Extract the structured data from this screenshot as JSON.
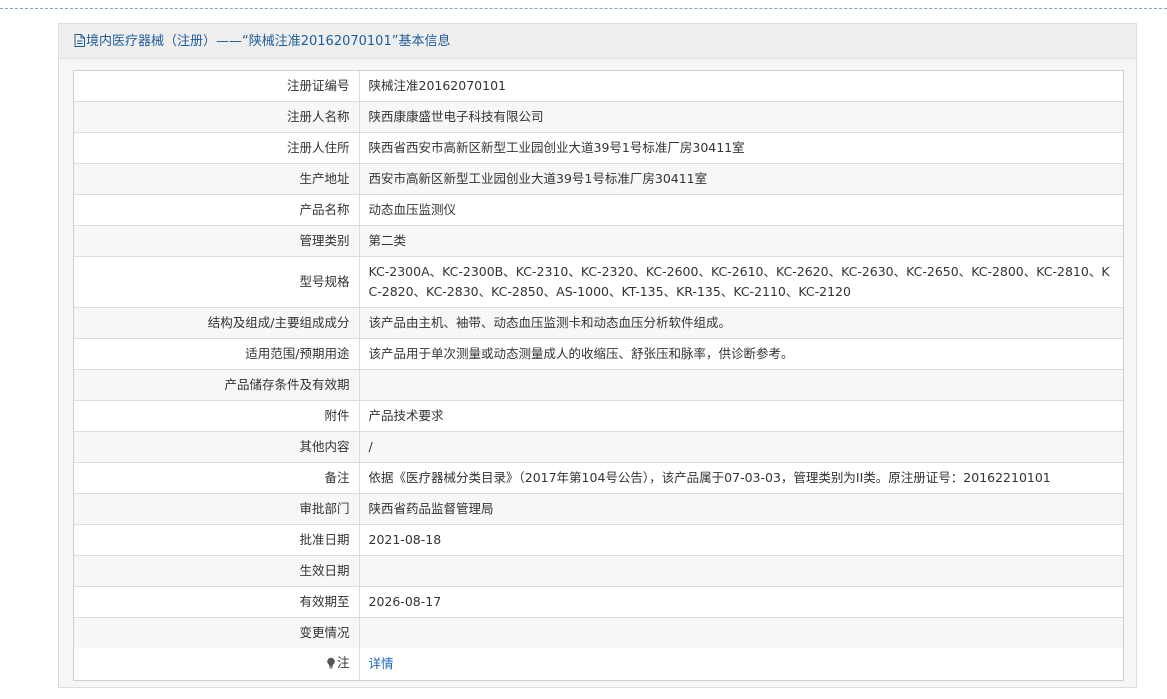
{
  "header": {
    "title": "境内医疗器械（注册）——“陕械注准20162070101”基本信息"
  },
  "rows": [
    {
      "label": "注册证编号",
      "value": "陕械注准20162070101"
    },
    {
      "label": "注册人名称",
      "value": "陕西康康盛世电子科技有限公司"
    },
    {
      "label": "注册人住所",
      "value": "陕西省西安市高新区新型工业园创业大道39号1号标准厂房30411室"
    },
    {
      "label": "生产地址",
      "value": "西安市高新区新型工业园创业大道39号1号标准厂房30411室"
    },
    {
      "label": "产品名称",
      "value": "动态血压监测仪"
    },
    {
      "label": "管理类别",
      "value": "第二类"
    },
    {
      "label": "型号规格",
      "value": "KC-2300A、KC-2300B、KC-2310、KC-2320、KC-2600、KC-2610、KC-2620、KC-2630、KC-2650、KC-2800、KC-2810、KC-2820、KC-2830、KC-2850、AS-1000、KT-135、KR-135、KC-2110、KC-2120"
    },
    {
      "label": "结构及组成/主要组成成分",
      "value": "该产品由主机、袖带、动态血压监测卡和动态血压分析软件组成。"
    },
    {
      "label": "适用范围/预期用途",
      "value": "该产品用于单次测量或动态测量成人的收缩压、舒张压和脉率，供诊断参考。"
    },
    {
      "label": "产品储存条件及有效期",
      "value": ""
    },
    {
      "label": "附件",
      "value": "产品技术要求"
    },
    {
      "label": "其他内容",
      "value": "/"
    },
    {
      "label": "备注",
      "value": "依据《医疗器械分类目录》（2017年第104号公告），该产品属于07-03-03，管理类别为II类。原注册证号：20162210101"
    },
    {
      "label": "审批部门",
      "value": "陕西省药品监督管理局"
    },
    {
      "label": "批准日期",
      "value": "2021-08-18"
    },
    {
      "label": "生效日期",
      "value": ""
    },
    {
      "label": "有效期至",
      "value": "2026-08-17"
    },
    {
      "label": "变更情况",
      "value": ""
    }
  ],
  "note_row": {
    "icon": "lightbulb-icon",
    "label": "注",
    "link_text": "详情"
  },
  "colors": {
    "header_text": "#1f5d99",
    "link": "#1a65b8",
    "border": "#dcdcdc"
  }
}
